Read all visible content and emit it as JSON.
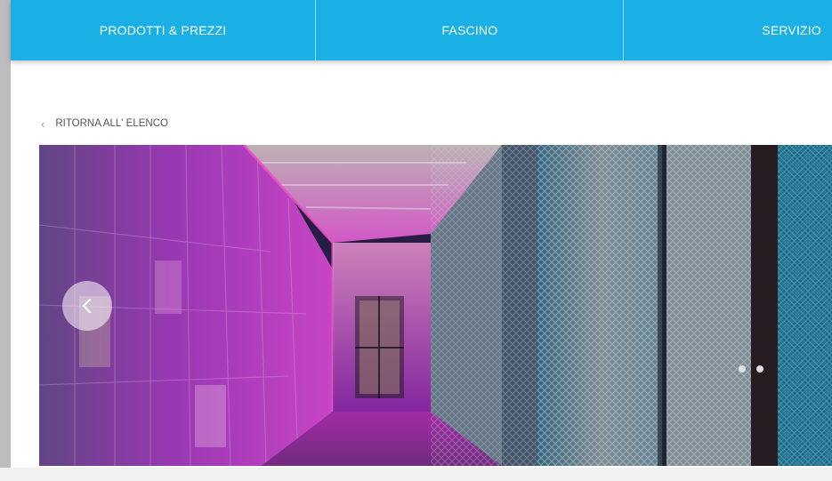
{
  "nav": {
    "items": [
      {
        "label": "PRODOTTI & PREZZI"
      },
      {
        "label": "FASCINO"
      },
      {
        "label": "SERVIZIO"
      }
    ],
    "accent": "#1ab0e6"
  },
  "back_link": {
    "icon": "chevron-left-icon",
    "label": "RITORNA ALL' ELENCO"
  },
  "gallery": {
    "image_description": "",
    "prev_icon": "chevron-left-icon"
  }
}
